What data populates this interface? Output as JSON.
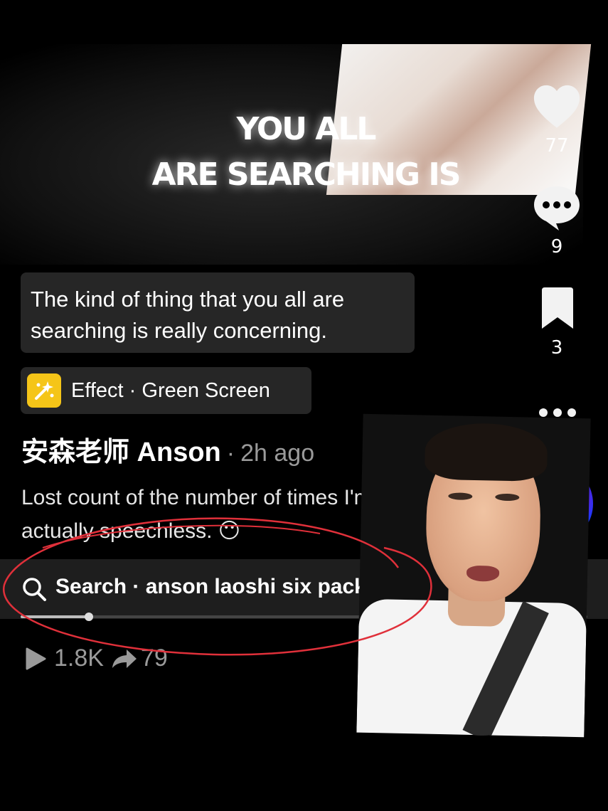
{
  "banner": {
    "line1": "YOU ALL",
    "line2": "ARE SEARCHING IS"
  },
  "rail": {
    "likes": "77",
    "comments": "9",
    "saves": "3"
  },
  "caption": {
    "text": "The kind of thing that you all are searching is really concerning."
  },
  "effect": {
    "label": "Effect · Green Screen"
  },
  "author": {
    "name": "安森老师 Anson",
    "separator": "·",
    "time": "2h ago"
  },
  "description": {
    "text": "Lost count of the number of times I'm actually speechless. 😶"
  },
  "search": {
    "text": "Search · anson laoshi six pack",
    "progress_percent": 12
  },
  "stats": {
    "views": "1.8K",
    "shares": "79"
  },
  "colors": {
    "background": "#000000",
    "chip_bg": "#262626",
    "muted_text": "#9a9a9a",
    "annotation": "#e0303a",
    "effect_icon": "#f5c518"
  }
}
